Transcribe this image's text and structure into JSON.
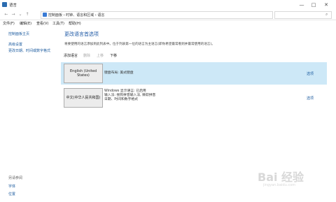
{
  "window": {
    "title": "语言"
  },
  "address": {
    "path": "控制面板  ›  时钟、语言和区域  ›  语言"
  },
  "menu": {
    "items": [
      "文件(F)",
      "编辑(E)",
      "查看(V)",
      "工具(T)",
      "帮助(H)"
    ]
  },
  "sidebar": {
    "home": "控制面板主页",
    "links": [
      "高级设置",
      "更改日期、时间或数字格式"
    ],
    "see_also_title": "另请参阅",
    "see_also": [
      "字体",
      "位置"
    ]
  },
  "main": {
    "title": "更改语言首选项",
    "description": "将要使用的语言添加到此列表中。位于列表第一位的语言为主语言(即你希望最常看到并最常使用的语言)。",
    "toolbar": {
      "add": "添加语言",
      "remove": "删除",
      "up": "上移",
      "down": "下移"
    },
    "languages": [
      {
        "name": "English (United States)",
        "info": [
          "键盘布局: 美式键盘"
        ],
        "option": "选项",
        "selected": true
      },
      {
        "name": "中文(中华人民共和国)",
        "info": [
          "Windows 显示语言: 已启用",
          "输入法: 搜狗拼音输入法, 微软拼音",
          "日期、时间和数字格式"
        ],
        "option": "选项",
        "selected": false
      }
    ]
  },
  "watermark": {
    "text": "Bai 经验",
    "sub": "jingyan.baidu.com"
  },
  "colors": {
    "accent": "#1f5aa6",
    "link": "#1a5a9e",
    "selected_row": "#cde8f7"
  }
}
